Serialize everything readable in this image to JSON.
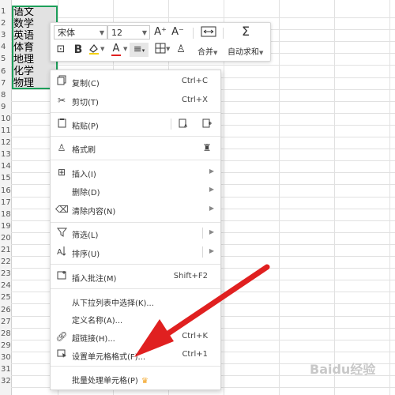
{
  "sheet": {
    "row_numbers": [
      "1",
      "2",
      "3",
      "4",
      "5",
      "6",
      "7",
      "8",
      "9",
      "10",
      "11",
      "12",
      "13",
      "14",
      "15",
      "16",
      "17",
      "18",
      "19",
      "20",
      "21",
      "22",
      "23",
      "24",
      "25",
      "26",
      "27",
      "28",
      "29",
      "30",
      "31",
      "32"
    ],
    "cells": [
      "语文",
      "数学",
      "英语",
      "体育",
      "地理",
      "化学",
      "物理"
    ]
  },
  "toolbar": {
    "font_name": "宋体",
    "font_size": "12",
    "merge_label": "合并",
    "autosum_label": "自动求和",
    "bold_label": "B",
    "font_color_label": "A",
    "increase_font_label": "A⁺",
    "decrease_font_label": "A⁻"
  },
  "menu": {
    "copy": {
      "label": "复制(C)",
      "shortcut": "Ctrl+C"
    },
    "cut": {
      "label": "剪切(T)",
      "shortcut": "Ctrl+X"
    },
    "paste": {
      "label": "粘贴(P)"
    },
    "format_painter": {
      "label": "格式刷"
    },
    "insert": {
      "label": "插入(I)"
    },
    "delete": {
      "label": "删除(D)"
    },
    "clear": {
      "label": "清除内容(N)"
    },
    "filter": {
      "label": "筛选(L)"
    },
    "sort": {
      "label": "排序(U)"
    },
    "insert_comment": {
      "label": "插入批注(M)",
      "shortcut": "Shift+F2"
    },
    "pick_from_list": {
      "label": "从下拉列表中选择(K)..."
    },
    "define_name": {
      "label": "定义名称(A)..."
    },
    "hyperlink": {
      "label": "超链接(H)...",
      "shortcut": "Ctrl+K"
    },
    "format_cells": {
      "label": "设置单元格格式(F)...",
      "shortcut": "Ctrl+1"
    },
    "batch_process": {
      "label": "批量处理单元格(P)"
    }
  },
  "watermark": "Baidu经验",
  "colors": {
    "selection_border": "#1d9f5a",
    "arrow": "#e02020",
    "crown": "#f2a322"
  }
}
